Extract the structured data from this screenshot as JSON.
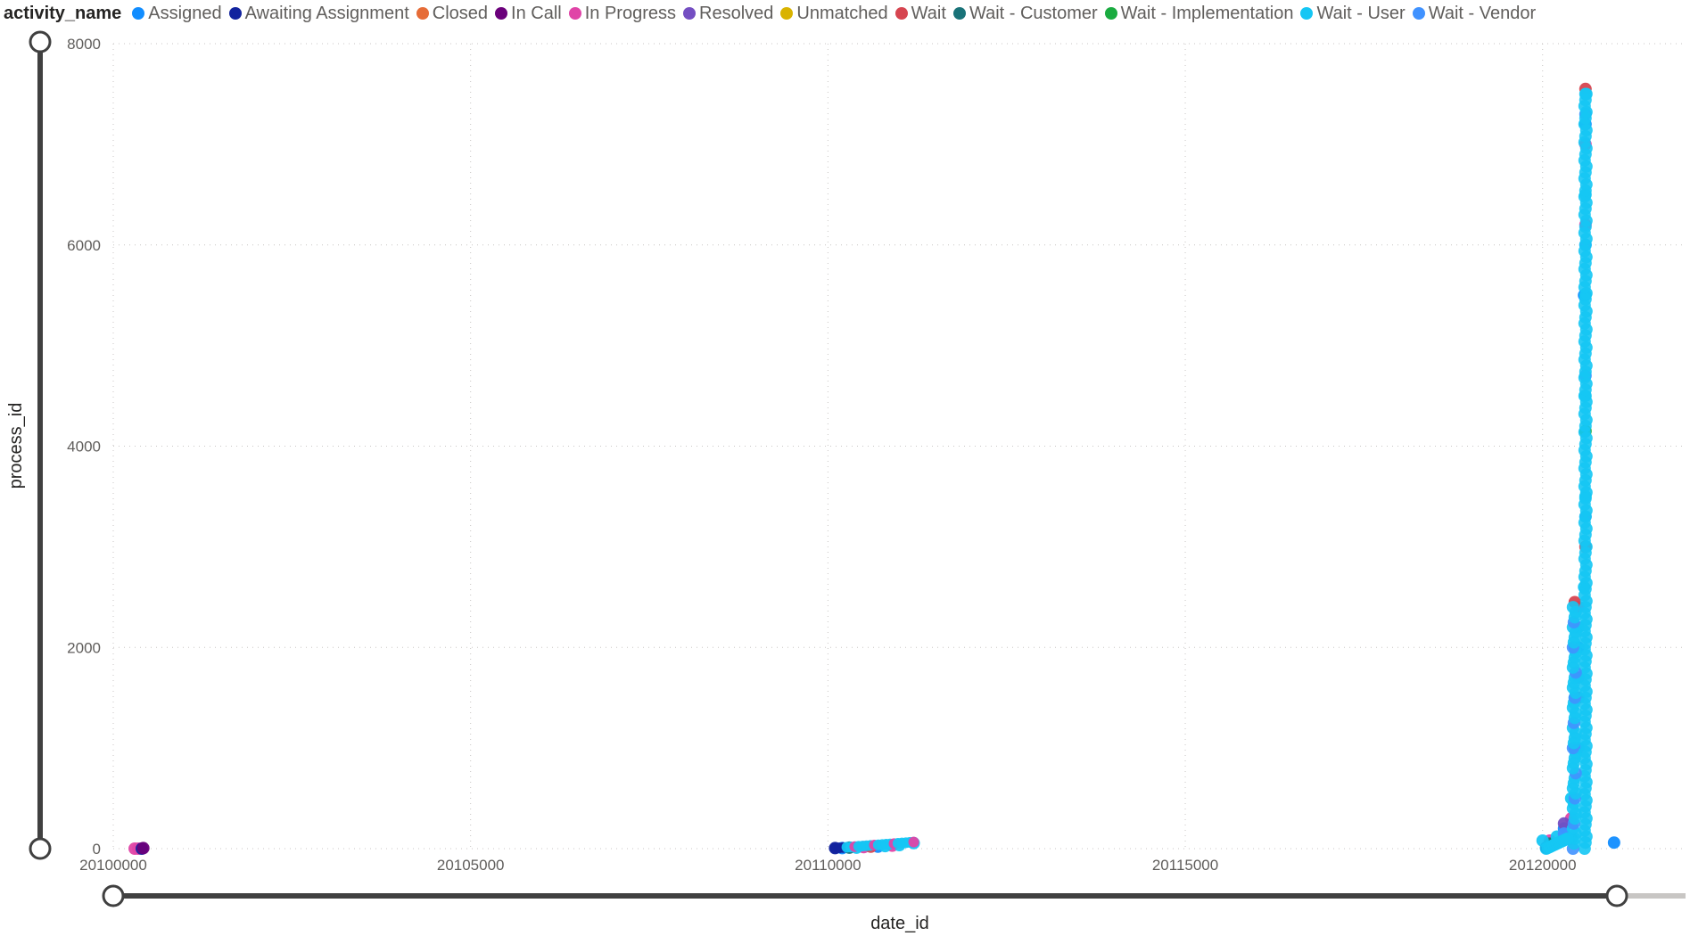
{
  "legend": {
    "title": "activity_name",
    "items": [
      {
        "label": "Assigned",
        "color": "#118DFF"
      },
      {
        "label": "Awaiting Assignment",
        "color": "#12239E"
      },
      {
        "label": "Closed",
        "color": "#E66C37"
      },
      {
        "label": "In Call",
        "color": "#6B007B"
      },
      {
        "label": "In Progress",
        "color": "#E044A7"
      },
      {
        "label": "Resolved",
        "color": "#744EC2"
      },
      {
        "label": "Unmatched",
        "color": "#D9B300"
      },
      {
        "label": "Wait",
        "color": "#D64550"
      },
      {
        "label": "Wait - Customer",
        "color": "#197278"
      },
      {
        "label": "Wait - Implementation",
        "color": "#1AAB40"
      },
      {
        "label": "Wait - User",
        "color": "#15C6F4"
      },
      {
        "label": "Wait - Vendor",
        "color": "#4092FF"
      }
    ]
  },
  "chart_data": {
    "type": "scatter",
    "title": "",
    "xlabel": "date_id",
    "ylabel": "process_id",
    "xlim": [
      20100000,
      20122000
    ],
    "ylim": [
      0,
      8000
    ],
    "x_ticks": [
      "20100000",
      "20105000",
      "20110000",
      "20115000",
      "20120000"
    ],
    "y_ticks": [
      "0",
      "2000",
      "4000",
      "6000",
      "8000"
    ],
    "grid": true,
    "legend_position": "top",
    "series": [
      {
        "name": "In Progress",
        "color": "#E044A7",
        "points": [
          [
            20100300,
            0
          ],
          [
            20100350,
            0
          ],
          [
            20110500,
            15
          ],
          [
            20110900,
            30
          ],
          [
            20120100,
            80
          ],
          [
            20120400,
            300
          ],
          [
            20120500,
            2400
          ],
          [
            20120600,
            6200
          ],
          [
            20120600,
            7000
          ]
        ]
      },
      {
        "name": "Awaiting Assignment",
        "color": "#12239E",
        "points": [
          [
            20100400,
            0
          ],
          [
            20110100,
            5
          ],
          [
            20120050,
            10
          ]
        ]
      },
      {
        "name": "In Call",
        "color": "#6B007B",
        "points": [
          [
            20100420,
            5
          ]
        ]
      },
      {
        "name": "Assigned",
        "color": "#118DFF",
        "points": [
          [
            20110200,
            5
          ],
          [
            20110700,
            20
          ],
          [
            20121000,
            60
          ],
          [
            20120300,
            200
          ],
          [
            20120500,
            2000
          ],
          [
            20120580,
            5500
          ],
          [
            20120600,
            7200
          ]
        ]
      },
      {
        "name": "Wait - Customer",
        "color": "#197278",
        "points": [
          [
            20110300,
            10
          ],
          [
            20120100,
            50
          ]
        ]
      },
      {
        "name": "Wait",
        "color": "#D64550",
        "points": [
          [
            20110600,
            20
          ],
          [
            20120450,
            2450
          ],
          [
            20120600,
            7550
          ],
          [
            20120600,
            3000
          ]
        ]
      },
      {
        "name": "Wait - Implementation",
        "color": "#1AAB40",
        "points": [
          [
            20120600,
            4150
          ],
          [
            20120400,
            100
          ]
        ]
      },
      {
        "name": "Resolved",
        "color": "#744EC2",
        "points": [
          [
            20120300,
            250
          ],
          [
            20120500,
            1500
          ]
        ]
      },
      {
        "name": "Wait - User",
        "color": "#15C6F4",
        "points": [
          [
            20110400,
            10
          ],
          [
            20110800,
            25
          ],
          [
            20111000,
            35
          ],
          [
            20111200,
            55
          ],
          [
            20120000,
            80
          ],
          [
            20120200,
            120
          ],
          [
            20120400,
            500
          ],
          [
            20120450,
            1000
          ],
          [
            20120450,
            1500
          ],
          [
            20120450,
            2000
          ],
          [
            20120500,
            2200
          ],
          [
            20120580,
            2600
          ],
          [
            20120600,
            3500
          ],
          [
            20120600,
            4500
          ],
          [
            20120600,
            5500
          ],
          [
            20120600,
            6500
          ],
          [
            20120600,
            7500
          ]
        ]
      },
      {
        "name": "Wait - Vendor",
        "color": "#4092FF",
        "points": [
          [
            20120300,
            150
          ],
          [
            20120500,
            1000
          ],
          [
            20120500,
            1700
          ],
          [
            20120600,
            3300
          ],
          [
            20120600,
            4700
          ],
          [
            20120600,
            6000
          ],
          [
            20120600,
            7300
          ]
        ]
      }
    ]
  }
}
